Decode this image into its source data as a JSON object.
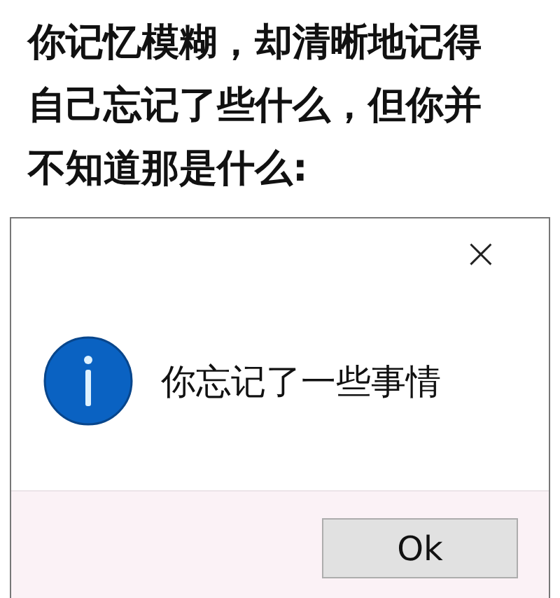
{
  "caption": "你记忆模糊，却清晰地记得自己忘记了些什么，但你并不知道那是什么:",
  "dialog": {
    "close": "×",
    "message": "你忘记了一些事情",
    "buttons": [
      {
        "label": "Ok",
        "selected": false
      }
    ]
  }
}
